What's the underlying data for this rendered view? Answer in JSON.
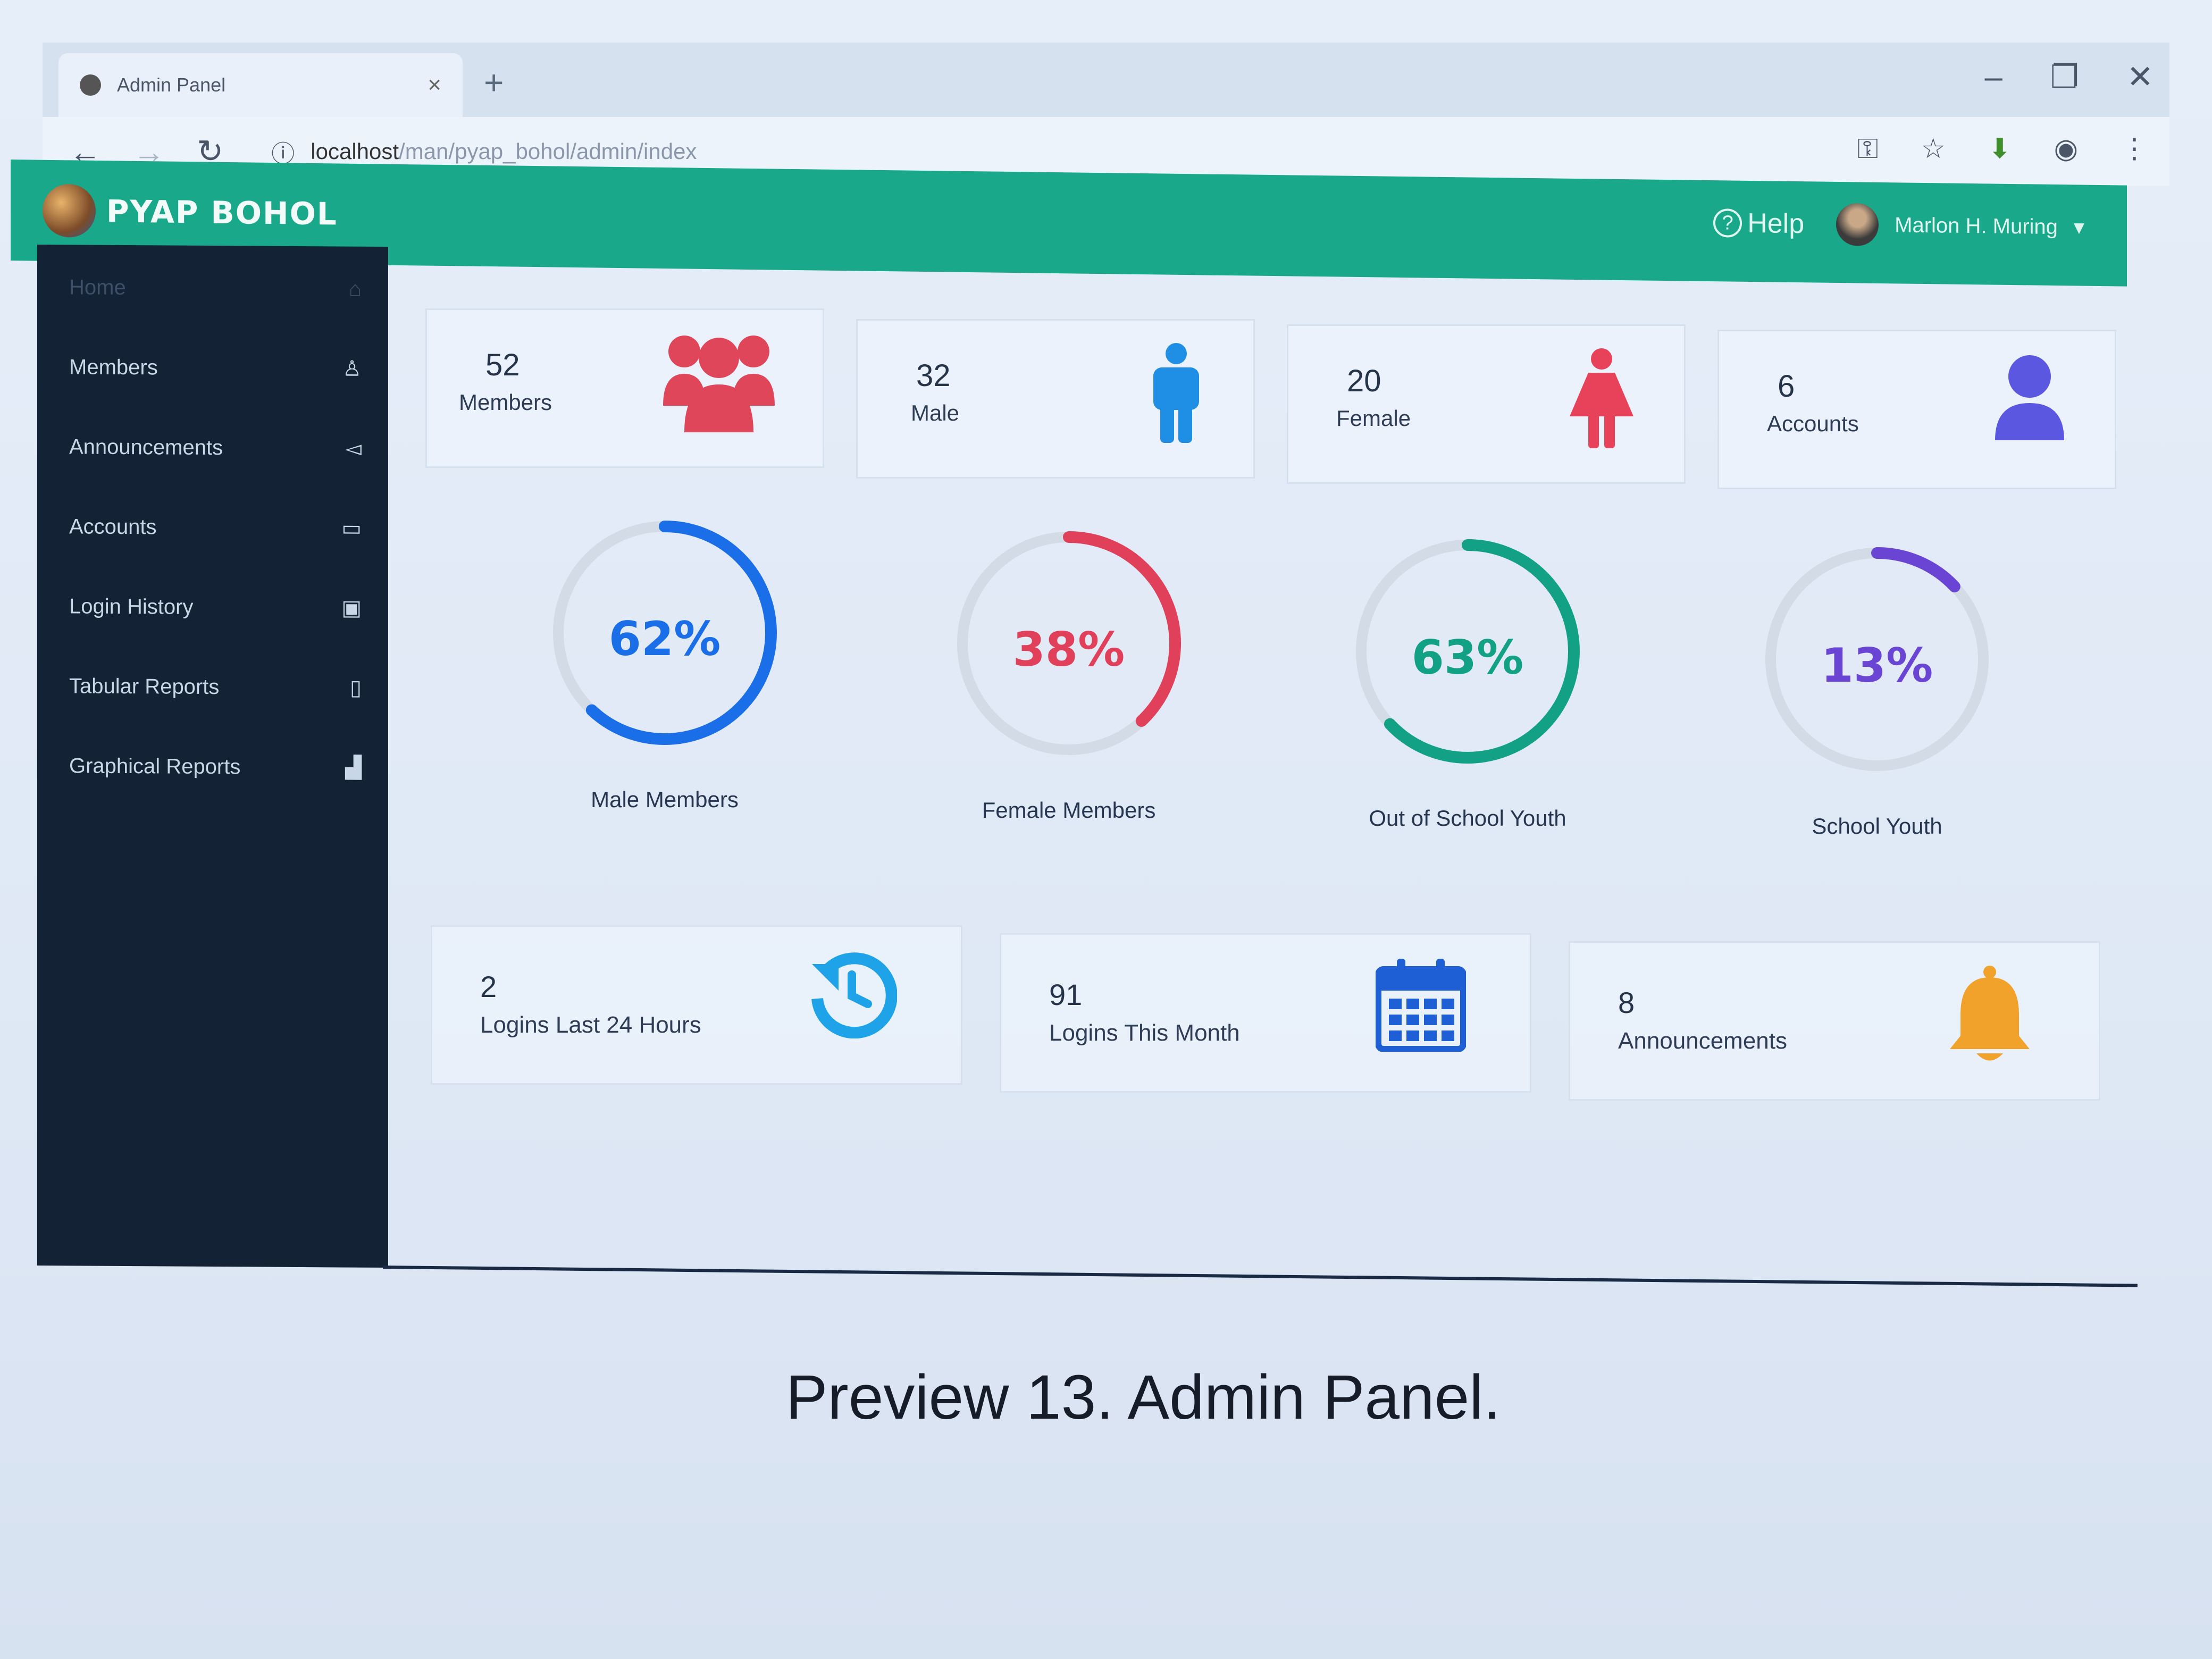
{
  "browser": {
    "tab_title": "Admin Panel",
    "tab_close": "×",
    "new_tab": "+",
    "url_host": "localhost",
    "url_path": "/man/pyap_bohol/admin/index",
    "win_minimize": "–",
    "win_restore": "❐",
    "win_close": "✕"
  },
  "header": {
    "brand": "PYAP BOHOL",
    "help_label": "Help",
    "user_name": "Marlon H. Muring",
    "user_caret": "▾",
    "accent_color": "#1aa88a"
  },
  "sidebar": {
    "items": [
      {
        "label": "Home",
        "icon": "home-icon",
        "glyph": "⌂",
        "active": true
      },
      {
        "label": "Members",
        "icon": "user-icon",
        "glyph": "♙"
      },
      {
        "label": "Announcements",
        "icon": "megaphone-icon",
        "glyph": "◅"
      },
      {
        "label": "Accounts",
        "icon": "card-icon",
        "glyph": "▭"
      },
      {
        "label": "Login History",
        "icon": "save-icon",
        "glyph": "▣"
      },
      {
        "label": "Tabular Reports",
        "icon": "report-icon",
        "glyph": "▯"
      },
      {
        "label": "Graphical Reports",
        "icon": "chart-icon",
        "glyph": "▟"
      }
    ]
  },
  "stats": [
    {
      "value": "52",
      "label": "Members",
      "icon": "users-group-icon",
      "color": "#e0465a"
    },
    {
      "value": "32",
      "label": "Male",
      "icon": "male-icon",
      "color": "#1f8fe6"
    },
    {
      "value": "20",
      "label": "Female",
      "icon": "female-icon",
      "color": "#e8425a"
    },
    {
      "value": "6",
      "label": "Accounts",
      "icon": "account-icon",
      "color": "#5b57e0"
    }
  ],
  "gauges": [
    {
      "percent": 62,
      "text": "62%",
      "label": "Male Members",
      "color": "#1a6ee8"
    },
    {
      "percent": 38,
      "text": "38%",
      "label": "Female Members",
      "color": "#e0405a"
    },
    {
      "percent": 63,
      "text": "63%",
      "label": "Out of School Youth",
      "color": "#13a186"
    },
    {
      "percent": 13,
      "text": "13%",
      "label": "School Youth",
      "color": "#6a45d4"
    }
  ],
  "bottom_stats": [
    {
      "value": "2",
      "label": "Logins Last 24 Hours",
      "icon": "history-icon",
      "color": "#1fa3e8"
    },
    {
      "value": "91",
      "label": "Logins This Month",
      "icon": "calendar-icon",
      "color": "#1e5fd6"
    },
    {
      "value": "8",
      "label": "Announcements",
      "icon": "bell-icon",
      "color": "#f0a22a"
    }
  ],
  "caption": "Preview 13. Admin Panel."
}
